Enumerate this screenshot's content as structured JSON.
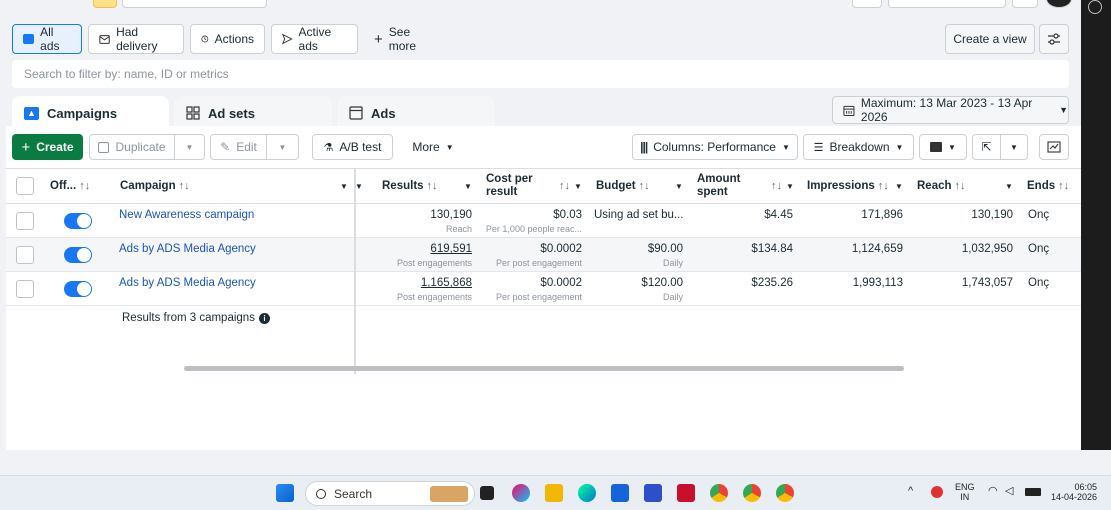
{
  "filters": {
    "all_ads": "All ads",
    "had_delivery": "Had delivery",
    "actions": "Actions",
    "active_ads": "Active ads",
    "see_more": "See more",
    "create_view": "Create a view"
  },
  "search": {
    "placeholder": "Search to filter by: name, ID or metrics"
  },
  "tabs": {
    "campaigns": "Campaigns",
    "ad_sets": "Ad sets",
    "ads": "Ads"
  },
  "date_range": "Maximum: 13 Mar 2023 - 13 Apr 2026",
  "toolbar": {
    "create": "Create",
    "duplicate": "Duplicate",
    "edit": "Edit",
    "ab_test": "A/B test",
    "more": "More",
    "columns": "Columns: Performance",
    "breakdown": "Breakdown"
  },
  "columns": {
    "off": "Off...",
    "campaign": "Campaign",
    "results": "Results",
    "cost_per_result_1": "Cost per",
    "cost_per_result_2": "result",
    "budget": "Budget",
    "amount_spent_1": "Amount",
    "amount_spent_2": "spent",
    "impressions": "Impressions",
    "reach": "Reach",
    "ends": "Ends"
  },
  "rows": [
    {
      "campaign": "New Awareness campaign",
      "results": "130,190",
      "results_sub": "Reach",
      "cost": "$0.03",
      "cost_sub": "Per 1,000 people reac...",
      "budget": "Using ad set bu...",
      "budget_sub": "",
      "spent": "$4.45",
      "impressions": "171,896",
      "reach": "130,190",
      "ends": "Onç"
    },
    {
      "campaign": "Ads by ADS Media Agency",
      "results": "619,591",
      "results_sub": "Post engagements",
      "cost": "$0.0002",
      "cost_sub": "Per post engagement",
      "budget": "$90.00",
      "budget_sub": "Daily",
      "spent": "$134.84",
      "impressions": "1,124,659",
      "reach": "1,032,950",
      "ends": "Onç"
    },
    {
      "campaign": "Ads by ADS Media Agency",
      "results": "1,165,868",
      "results_sub": "Post engagements",
      "cost": "$0.0002",
      "cost_sub": "Per post engagement",
      "budget": "$120.00",
      "budget_sub": "Daily",
      "spent": "$235.26",
      "impressions": "1,993,113",
      "reach": "1,743,057",
      "ends": "Onç"
    }
  ],
  "summary": "Results from 3 campaigns",
  "taskbar": {
    "search": "Search",
    "lang_1": "ENG",
    "lang_2": "IN",
    "time": "06:05",
    "date": "14-04-2026"
  }
}
